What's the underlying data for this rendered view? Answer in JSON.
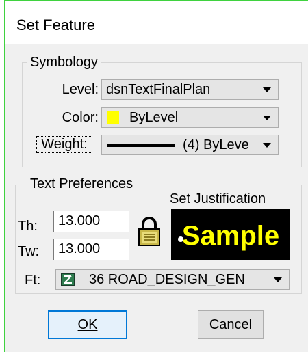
{
  "window": {
    "title": "Set Feature"
  },
  "symbology": {
    "group_label": "Symbology",
    "level_label": "Level:",
    "level_value": "dsnTextFinalPlan",
    "color_label": "Color:",
    "color_value": "ByLevel",
    "color_swatch": "#ffff00",
    "weight_label": "Weight:",
    "weight_value": "(4) ByLeve"
  },
  "text_prefs": {
    "group_label": "Text Preferences",
    "justification_label": "Set Justification",
    "th_label": "Th:",
    "th_value": "13.000",
    "tw_label": "Tw:",
    "tw_value": "13.000",
    "ft_label": "Ft:",
    "ft_value": "36 ROAD_DESIGN_GEN",
    "sample_text": "Sample"
  },
  "buttons": {
    "ok": "OK",
    "cancel": "Cancel"
  }
}
